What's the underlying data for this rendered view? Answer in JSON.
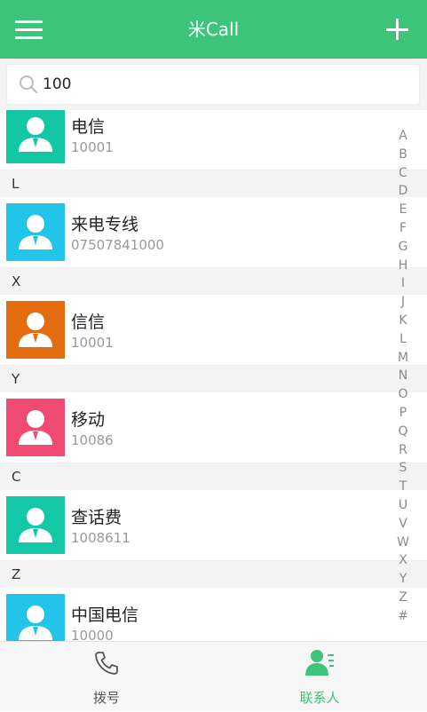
{
  "header": {
    "title": "米Call"
  },
  "search": {
    "value": "100"
  },
  "contacts": [
    {
      "section": "",
      "name": "电信",
      "number": "10001",
      "color": "#13c7a4"
    },
    {
      "section": "L",
      "name": "来电专线",
      "number": "07507841000",
      "color": "#22c4e8"
    },
    {
      "section": "X",
      "name": "信信",
      "number": "10001",
      "color": "#e36d0e"
    },
    {
      "section": "Y",
      "name": "移动",
      "number": "10086",
      "color": "#ef4b73"
    },
    {
      "section": "C",
      "name": "查话费",
      "number": "1008611",
      "color": "#12c8a6"
    },
    {
      "section": "Z",
      "name": "中国电信",
      "number": "10000",
      "color": "#22c4e8"
    }
  ],
  "alpha_index": [
    "A",
    "B",
    "C",
    "D",
    "E",
    "F",
    "G",
    "H",
    "I",
    "J",
    "K",
    "L",
    "M",
    "N",
    "O",
    "P",
    "Q",
    "R",
    "S",
    "T",
    "U",
    "V",
    "W",
    "X",
    "Y",
    "Z",
    "#"
  ],
  "bottom_nav": {
    "dial_label": "拨号",
    "contacts_label": "联系人",
    "active_color": "#3cc57a"
  }
}
